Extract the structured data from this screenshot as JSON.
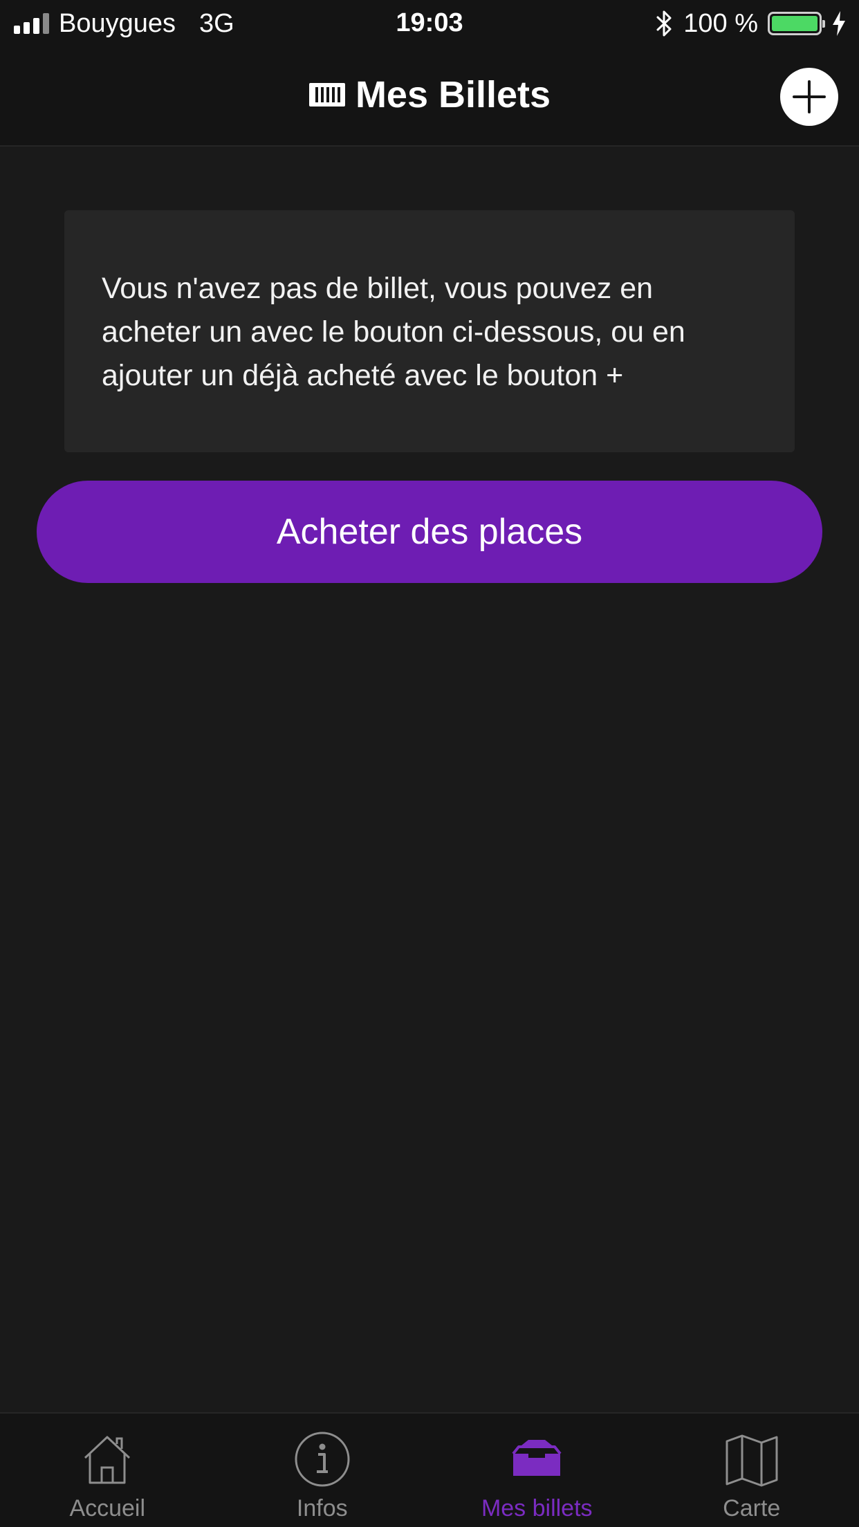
{
  "status_bar": {
    "carrier": "Bouygues",
    "network": "3G",
    "time": "19:03",
    "battery": "100 %",
    "battery_color": "#4cd964"
  },
  "header": {
    "title": "Mes Billets",
    "title_icon": "ticket-icon",
    "add_icon": "plus-icon"
  },
  "main": {
    "info_text": "Vous n'avez pas de billet, vous pouvez en acheter un avec le bouton ci-dessous, ou en ajouter un déjà acheté avec le bouton +",
    "buy_label": "Acheter des places",
    "accent_color": "#6e1db3"
  },
  "tabs": [
    {
      "label": "Accueil",
      "icon": "home-icon",
      "active": false
    },
    {
      "label": "Infos",
      "icon": "info-icon",
      "active": false
    },
    {
      "label": "Mes billets",
      "icon": "inbox-icon",
      "active": true
    },
    {
      "label": "Carte",
      "icon": "map-icon",
      "active": false
    }
  ]
}
